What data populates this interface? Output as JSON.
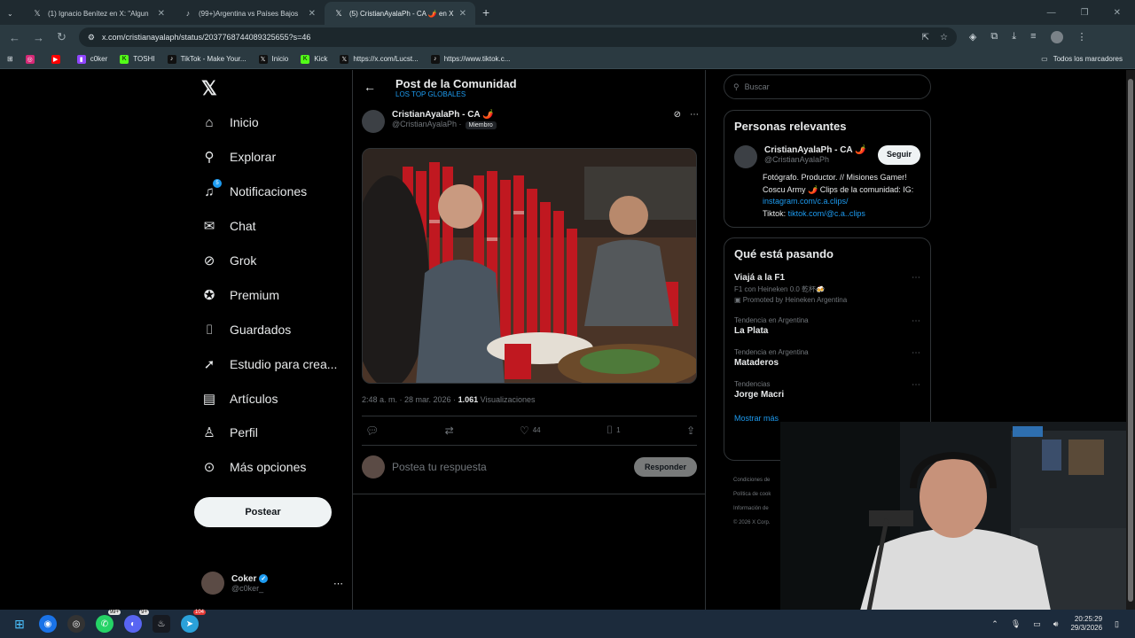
{
  "browser": {
    "tabs": [
      {
        "title": "(1) Ignacio Benítez en X: \"Algun",
        "icon": "x-icon",
        "active": false
      },
      {
        "title": "(99+)Argentina vs Países Bajos",
        "icon": "tiktok-icon",
        "active": false
      },
      {
        "title": "(5) CristianAyalaPh - CA 🌶️ en X",
        "icon": "x-icon",
        "active": true
      }
    ],
    "url": "x.com/cristianayalaph/status/2037768744089325655?s=46",
    "bookmarks": [
      {
        "label": "",
        "icon": "instagram-icon",
        "color": "#d62976"
      },
      {
        "label": "",
        "icon": "youtube-icon",
        "color": "#ff0000"
      },
      {
        "label": "c0ker",
        "icon": "twitch-icon",
        "color": "#9146ff"
      },
      {
        "label": "TOSHI",
        "icon": "kick-icon",
        "color": "#53fc18"
      },
      {
        "label": "TikTok - Make Your...",
        "icon": "tiktok-icon",
        "color": "#111111"
      },
      {
        "label": "Inicio",
        "icon": "x-icon",
        "color": "#111111"
      },
      {
        "label": "Kick",
        "icon": "kick-icon",
        "color": "#53fc18"
      },
      {
        "label": "https://x.com/Lucst...",
        "icon": "x-icon",
        "color": "#111111"
      },
      {
        "label": "https://www.tiktok.c...",
        "icon": "tiktok-icon",
        "color": "#111111"
      }
    ],
    "all_bookmarks": "Todos los marcadores"
  },
  "nav": {
    "items": [
      {
        "label": "Inicio",
        "icon": "home-icon",
        "glyph": "⌂"
      },
      {
        "label": "Explorar",
        "icon": "search-icon",
        "glyph": "⚲"
      },
      {
        "label": "Notificaciones",
        "icon": "bell-icon",
        "glyph": "🔔︎"
      },
      {
        "label": "Chat",
        "icon": "mail-icon",
        "glyph": "✉"
      },
      {
        "label": "Grok",
        "icon": "grok-icon",
        "glyph": "⊘"
      },
      {
        "label": "Premium",
        "icon": "premium-icon",
        "glyph": "✓"
      },
      {
        "label": "Guardados",
        "icon": "bookmark-icon",
        "glyph": "⌷"
      },
      {
        "label": "Estudio para crea...",
        "icon": "rocket-icon",
        "glyph": "➚"
      },
      {
        "label": "Artículos",
        "icon": "articles-icon",
        "glyph": "▤"
      },
      {
        "label": "Perfil",
        "icon": "profile-icon",
        "glyph": "♙"
      },
      {
        "label": "Más opciones",
        "icon": "more-circle-icon",
        "glyph": "⋯"
      }
    ],
    "notifications_badge": "5",
    "post_button": "Postear",
    "account": {
      "name": "Coker",
      "handle": "@c0ker_"
    }
  },
  "post": {
    "header_title": "Post de la Comunidad",
    "header_sub": "LOS TOP GLOBALES",
    "author_name": "CristianAyalaPh - CA 🌶️",
    "author_handle": "@CristianAyalaPh ·",
    "member_badge": "Miembro",
    "time": "2:48 a. m. · 28 mar. 2026 ·",
    "views": "1.061",
    "views_label": "Visualizaciones",
    "likes": "44",
    "bookmarks": "1",
    "reply_placeholder": "Postea tu respuesta",
    "reply_button": "Responder"
  },
  "sidebar": {
    "search_placeholder": "Buscar",
    "relevant_title": "Personas relevantes",
    "relevant_name": "CristianAyalaPh - CA 🌶️",
    "relevant_handle": "@CristianAyalaPh",
    "follow": "Seguir",
    "bio_1": "Fotógrafo. Productor. // Misiones Gamer! Coscu Army 🌶️ Clips de la comunidad: IG: ",
    "bio_link1": "instagram.com/c.a.clips/",
    "bio_2": "Tiktok: ",
    "bio_link2": "tiktok.com/@c.a..clips",
    "trends_title": "Qué está pasando",
    "trends": [
      {
        "context": "",
        "name": "Viajá a la F1",
        "sub": "F1 con Heineken 0.0 乾杯🍻",
        "promo": "Promoted by Heineken Argentina"
      },
      {
        "context": "Tendencia en Argentina",
        "name": "La Plata",
        "sub": "",
        "promo": ""
      },
      {
        "context": "Tendencia en Argentina",
        "name": "Mataderos",
        "sub": "",
        "promo": ""
      },
      {
        "context": "Tendencias",
        "name": "Jorge Macri",
        "sub": "",
        "promo": ""
      }
    ],
    "show_more": "Mostrar más",
    "footer": [
      "Condiciones de",
      "Política de cook",
      "Información de",
      "© 2026 X Corp."
    ]
  },
  "taskbar": {
    "whatsapp_badge": "99+",
    "discord_badge": "9+",
    "telegram_badge": "104",
    "time": "20:25:29",
    "date": "29/3/2026"
  }
}
